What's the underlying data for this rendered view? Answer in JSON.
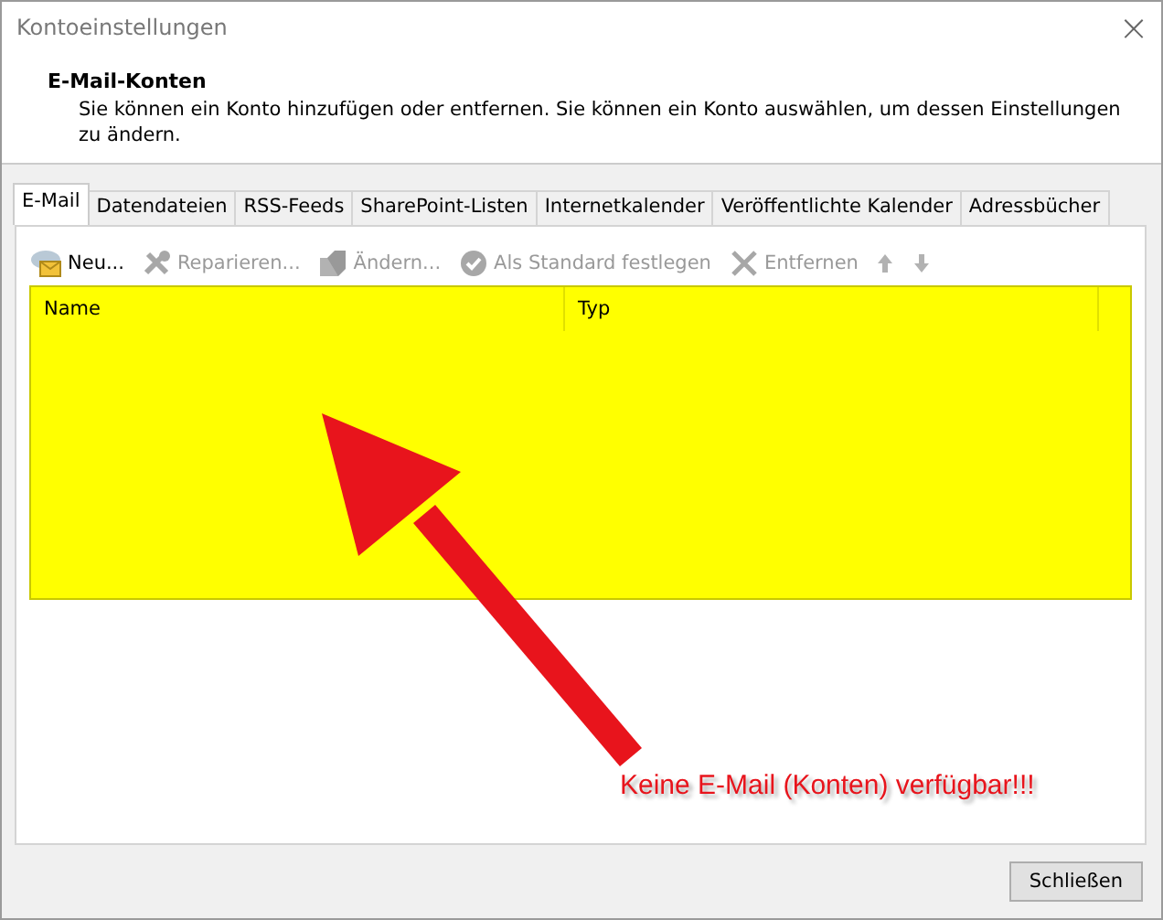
{
  "window": {
    "title": "Kontoeinstellungen",
    "close": "×"
  },
  "header": {
    "title": "E-Mail-Konten",
    "description": "Sie können ein Konto hinzufügen oder entfernen. Sie können ein Konto auswählen, um dessen Einstellungen zu ändern."
  },
  "tabs": [
    {
      "label": "E-Mail",
      "selected": true
    },
    {
      "label": "Datendateien",
      "selected": false
    },
    {
      "label": "RSS-Feeds",
      "selected": false
    },
    {
      "label": "SharePoint-Listen",
      "selected": false
    },
    {
      "label": "Internetkalender",
      "selected": false
    },
    {
      "label": "Veröffentlichte Kalender",
      "selected": false
    },
    {
      "label": "Adressbücher",
      "selected": false
    }
  ],
  "toolbar": [
    {
      "kind": "new",
      "label": "Neu...",
      "disabled": false
    },
    {
      "kind": "repair",
      "label": "Reparieren...",
      "disabled": true
    },
    {
      "kind": "change",
      "label": "Ändern...",
      "disabled": true
    },
    {
      "kind": "default",
      "label": "Als Standard festlegen",
      "disabled": true
    },
    {
      "kind": "remove",
      "label": "Entfernen",
      "disabled": true
    },
    {
      "kind": "up",
      "disabled": true
    },
    {
      "kind": "down",
      "disabled": true
    }
  ],
  "table": {
    "columns": [
      "Name",
      "Typ"
    ]
  },
  "annotation": {
    "text": "Keine E-Mail (Konten) verfügbar!!!",
    "color": "#e8141c"
  },
  "buttons": [
    "Schließen"
  ]
}
